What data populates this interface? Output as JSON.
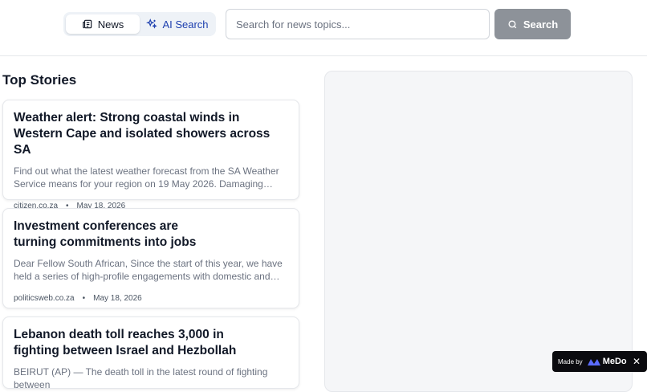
{
  "header": {
    "mode_toggle": {
      "news_label": "News",
      "ai_label": "AI Search"
    },
    "search": {
      "placeholder": "Search for news topics...",
      "button_label": "Search"
    }
  },
  "main": {
    "section_title": "Top Stories",
    "stories": [
      {
        "title": "Weather alert: Strong coastal winds in\nWestern Cape and isolated showers across SA",
        "snippet": "Find out what the latest weather forecast from the SA Weather Service means for your region on 19 May 2026. Damaging coastal winds are...",
        "source": "citizen.co.za",
        "date": "May 18, 2026"
      },
      {
        "title": "Investment conferences are\nturning commitments into jobs",
        "snippet": "Dear Fellow South African, Since the start of this year, we have held a series of high-profile engagements with domestic and international...",
        "source": "politicsweb.co.za",
        "date": "May 18, 2026"
      },
      {
        "title": "Lebanon death toll reaches 3,000 in\nfighting between Israel and Hezbollah",
        "snippet": "BEIRUT (AP) — The death toll in the latest round of fighting between",
        "source": "",
        "date": ""
      }
    ]
  },
  "badge": {
    "made_by": "Made by",
    "brand": "MeDo",
    "close": "✕"
  },
  "icons": {
    "news": "newspaper-icon",
    "ai": "sparkles-icon",
    "search": "search-icon",
    "close": "close-icon"
  },
  "colors": {
    "accent": "#1e40af",
    "search_button": "#8d9299"
  }
}
